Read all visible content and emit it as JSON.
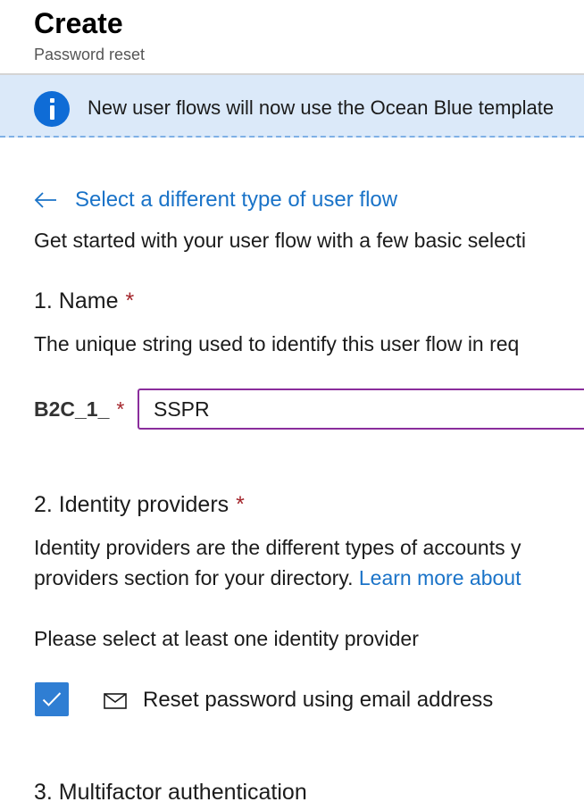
{
  "header": {
    "title": "Create",
    "subtitle": "Password reset"
  },
  "banner": {
    "icon": "info-icon",
    "text": "New user flows will now use the Ocean Blue template"
  },
  "back_link": {
    "icon": "arrow-left-icon",
    "label": "Select a different type of user flow"
  },
  "intro": "Get started with your user flow with a few basic selecti",
  "sections": {
    "name": {
      "heading": "1. Name",
      "required_mark": "*",
      "description": "The unique string used to identify this user flow in req",
      "prefix_label": "B2C_1_",
      "input_value": "SSPR"
    },
    "identity_providers": {
      "heading": "2. Identity providers",
      "required_mark": "*",
      "description_line1": "Identity providers are the different types of accounts y",
      "description_line2": "providers section for your directory.",
      "learn_more_link": "Learn more about",
      "select_prompt": "Please select at least one identity provider",
      "option": {
        "checked": true,
        "icon": "mail-icon",
        "label": "Reset password using email address"
      }
    },
    "mfa": {
      "heading": "3. Multifactor authentication"
    }
  },
  "colors": {
    "accent": "#1a73c8",
    "checkbox": "#2f7ed3",
    "banner_bg": "#dbe9f9",
    "info_icon": "#0f6cd6",
    "required": "#a4262c",
    "input_border": "#8a2d9c"
  }
}
